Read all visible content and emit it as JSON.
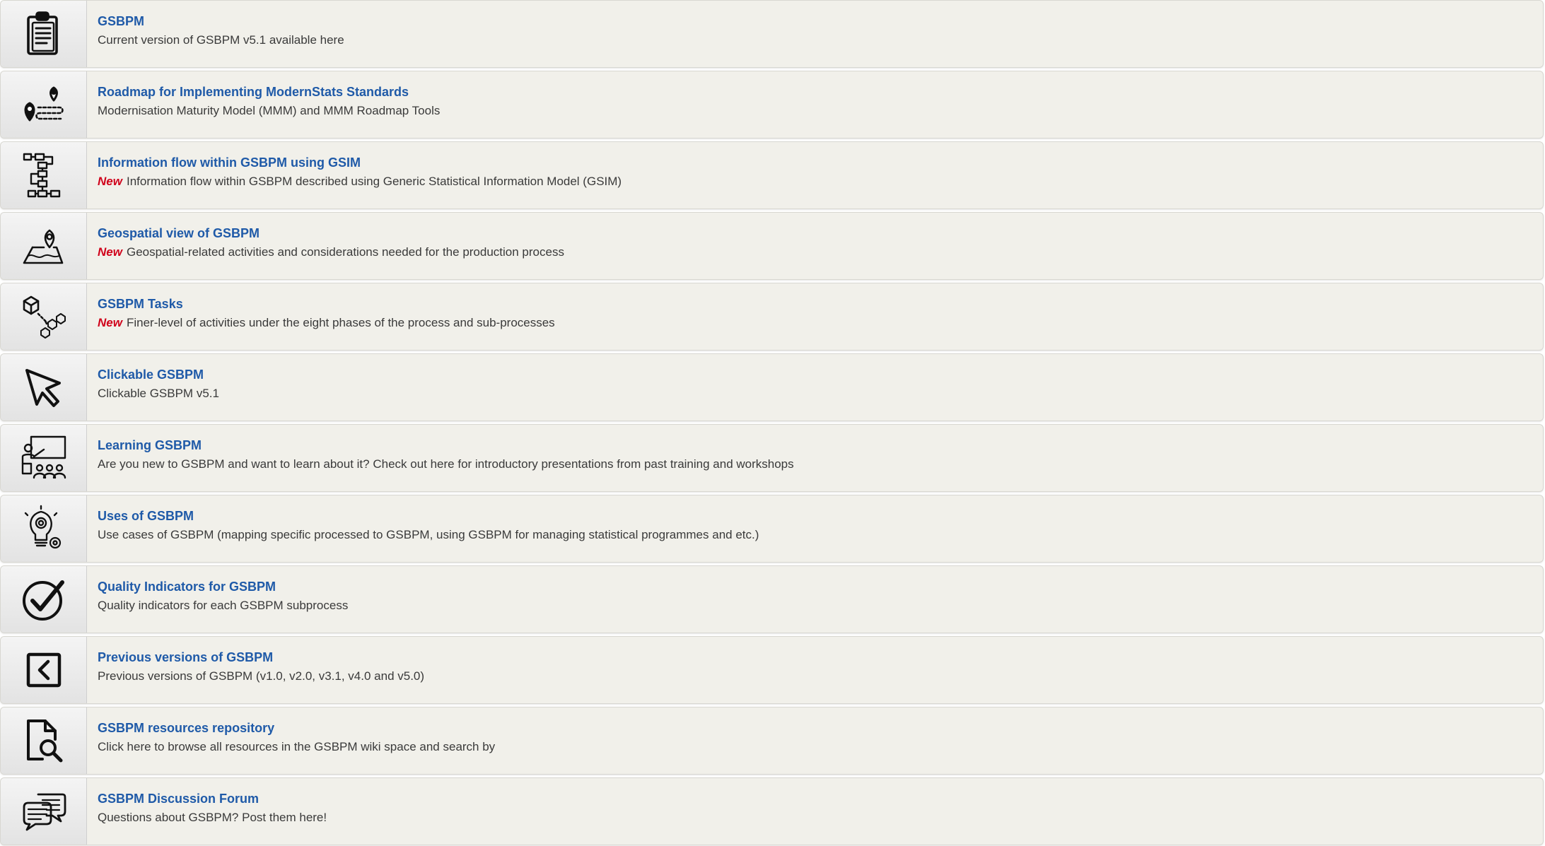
{
  "items": [
    {
      "title": "GSBPM",
      "new_tag": "",
      "description": "Current version of GSBPM v5.1 available here",
      "icon": "document-icon"
    },
    {
      "title": "Roadmap for Implementing ModernStats Standards",
      "new_tag": "",
      "description": "Modernisation Maturity Model (MMM) and MMM Roadmap Tools",
      "icon": "roadmap-icon"
    },
    {
      "title": "Information flow within GSBPM using GSIM",
      "new_tag": "New",
      "description": "Information flow within GSBPM described using Generic Statistical Information Model (GSIM)",
      "icon": "flow-diagram-icon"
    },
    {
      "title": "Geospatial view of GSBPM",
      "new_tag": "New",
      "description": "Geospatial-related activities and considerations needed for the production process",
      "icon": "map-pin-icon"
    },
    {
      "title": "GSBPM Tasks",
      "new_tag": "New",
      "description": "Finer-level of activities under the eight phases of the process and sub-processes",
      "icon": "tasks-icon"
    },
    {
      "title": "Clickable GSBPM",
      "new_tag": "",
      "description": "Clickable GSBPM v5.1",
      "icon": "cursor-icon"
    },
    {
      "title": "Learning GSBPM",
      "new_tag": "",
      "description": "Are you new to GSBPM and want to learn about it? Check out here for introductory presentations from past training and workshops",
      "icon": "presentation-icon"
    },
    {
      "title": "Uses of GSBPM",
      "new_tag": "",
      "description": "Use cases of GSBPM (mapping specific processed to GSBPM, using GSBPM for managing statistical programmes and etc.)",
      "icon": "lightbulb-gear-icon"
    },
    {
      "title": "Quality Indicators for GSBPM",
      "new_tag": "",
      "description": "Quality indicators for each GSBPM subprocess",
      "icon": "checkmark-icon"
    },
    {
      "title": "Previous versions of GSBPM",
      "new_tag": "",
      "description": "Previous versions of GSBPM (v1.0, v2.0, v3.1, v4.0 and v5.0)",
      "icon": "back-arrow-icon"
    },
    {
      "title": "GSBPM resources repository",
      "new_tag": "",
      "description": "Click here to browse all resources in the GSBPM wiki space and search by",
      "icon": "document-search-icon"
    },
    {
      "title": "GSBPM Discussion Forum",
      "new_tag": "",
      "description": "Questions about GSBPM? Post them here!",
      "icon": "chat-bubbles-icon"
    }
  ]
}
